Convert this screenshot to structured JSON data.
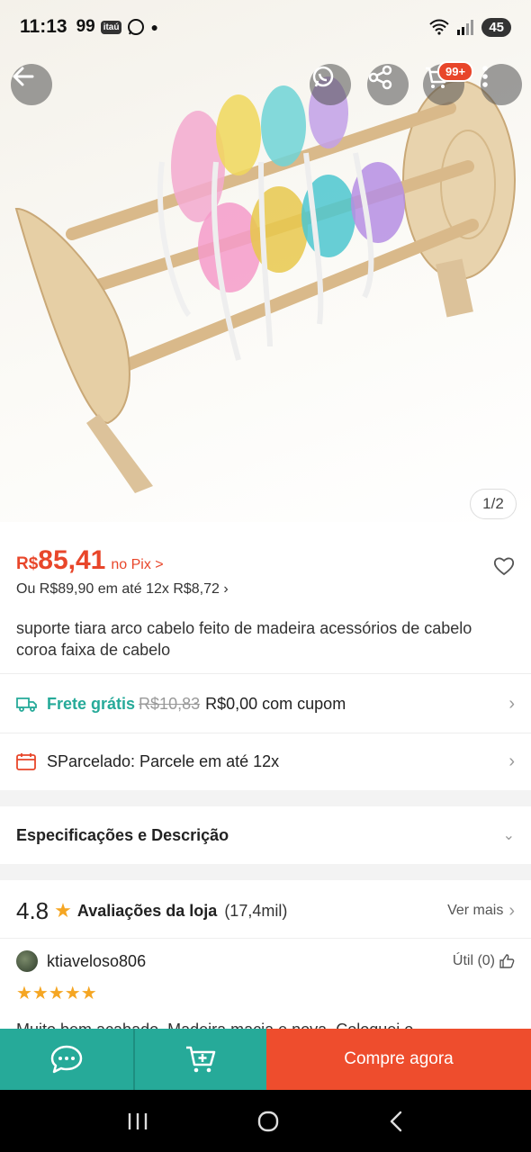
{
  "status_bar": {
    "time": "11:13",
    "left_badge": "99",
    "bank_label": "itaú",
    "battery": "45"
  },
  "gallery": {
    "counter": "1/2",
    "cart_badge": "99+"
  },
  "product": {
    "currency": "R$",
    "price": "85,41",
    "pix_label": "no Pix >",
    "installment": "Ou R$89,90 em até 12x R$8,72 ›",
    "title": "suporte tiara arco cabelo feito de madeira acessórios de cabelo coroa faixa de cabelo"
  },
  "shipping": {
    "label": "Frete grátis",
    "old_price": "R$10,83",
    "new_price": "R$0,00 com cupom"
  },
  "installments": {
    "label": "SParcelado: Parcele em até 12x"
  },
  "specs": {
    "label": "Especificações e Descrição"
  },
  "ratings": {
    "score": "4.8",
    "label": "Avaliações da loja",
    "count": "(17,4mil)",
    "see_more": "Ver mais"
  },
  "review": {
    "username": "ktiaveloso806",
    "useful": "Útil (0)",
    "stars": "★★★★★",
    "text": "Muito bem acabado. Madeira macia e nova. Coloquei o"
  },
  "bottom_bar": {
    "buy_now": "Compre agora"
  },
  "colors": {
    "accent": "#ee4d2d",
    "teal": "#26aa99"
  }
}
